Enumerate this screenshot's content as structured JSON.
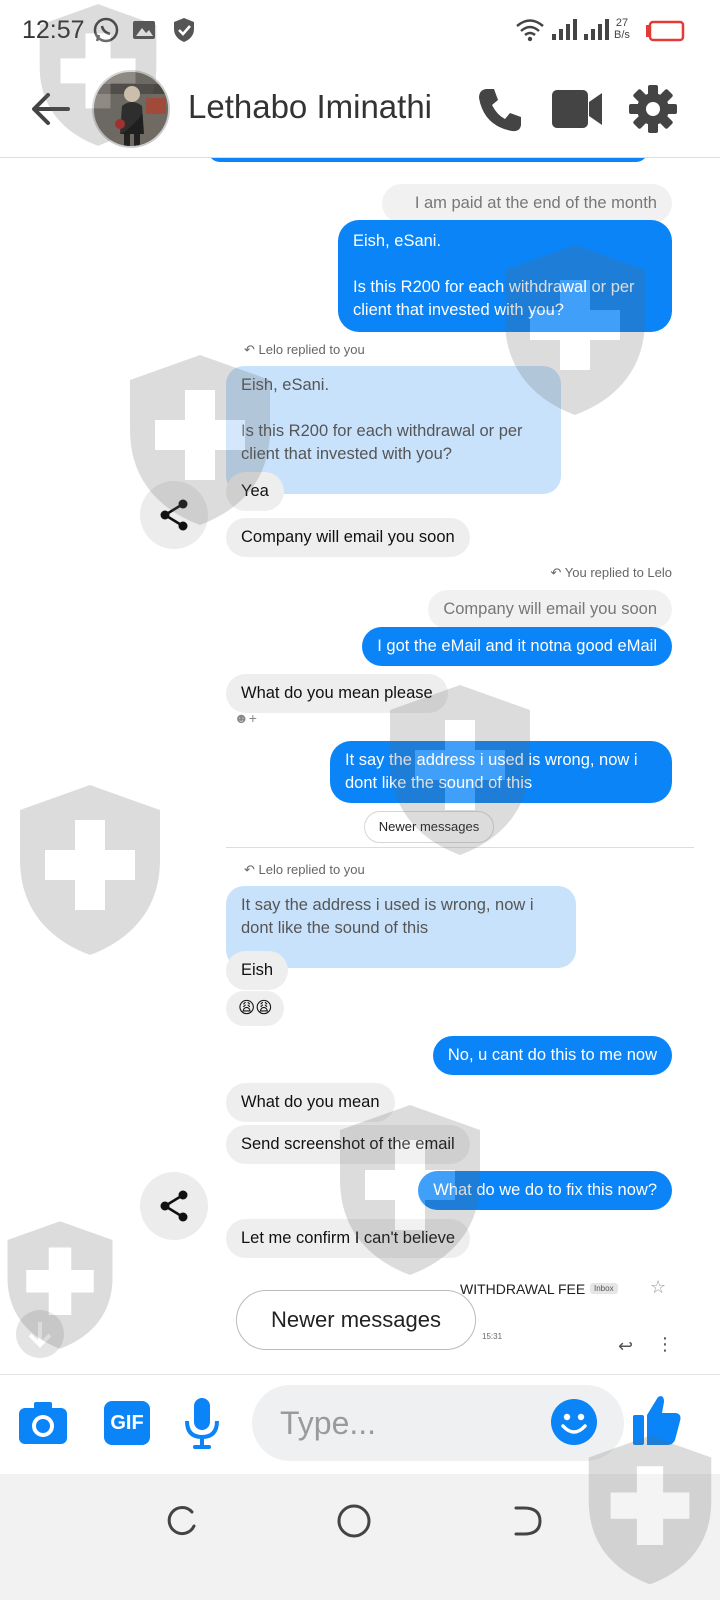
{
  "status_bar": {
    "time": "12:57",
    "net_speed_value": "27",
    "net_speed_unit": "B/s",
    "icons": [
      "whatsapp-icon",
      "gallery-icon",
      "shield-icon",
      "wifi-icon",
      "signal-icon",
      "signal-icon",
      "battery-icon"
    ]
  },
  "header": {
    "contact_name": "Lethabo Iminathi",
    "icons": [
      "back-arrow-icon",
      "phone-icon",
      "video-icon",
      "gear-icon"
    ]
  },
  "messages": {
    "m1_quote": "I am paid at the end of the month",
    "m2": "Eish, eSani.\n\nIs this R200 for each withdrawal or per client that invested with you?",
    "reply1_label": "Lelo replied to you",
    "m3_quote": "Eish, eSani.\n\nIs this R200 for each withdrawal or per client that invested with you?",
    "m4": "Yea",
    "m5": "Company will email you soon",
    "reply2_label": "You replied to Lelo",
    "m6_quote": "Company will email you soon",
    "m7": "I got the eMail and it notna good eMail",
    "m8": "What do you mean please",
    "m9": "It say the address i used is wrong, now i dont like the sound of this",
    "newer_small": "Newer messages",
    "reply3_label": "Lelo replied to you",
    "m10_quote": "It say the address i used is wrong, now i dont like the sound of this",
    "m11": "Eish",
    "m12": "😩😩",
    "m13": "No, u cant do this to me now",
    "m14": "What do you mean",
    "m15": "Send screenshot of the email",
    "m16": "What do we do to fix this now?",
    "m17": "Let me confirm I can't believe"
  },
  "email_preview": {
    "subject": "WITHDRAWAL FEE",
    "label": "Inbox",
    "time": "15:31"
  },
  "newer_messages_button": "Newer messages",
  "composer": {
    "placeholder": "Type...",
    "gif_label": "GIF",
    "icons": [
      "camera-icon",
      "gif-icon",
      "microphone-icon",
      "emoji-icon",
      "thumbs-up-icon"
    ]
  },
  "colors": {
    "accent": "#0a84f7",
    "quote_blue": "#c9e2fb",
    "bubble_gray": "#eeeeee"
  }
}
